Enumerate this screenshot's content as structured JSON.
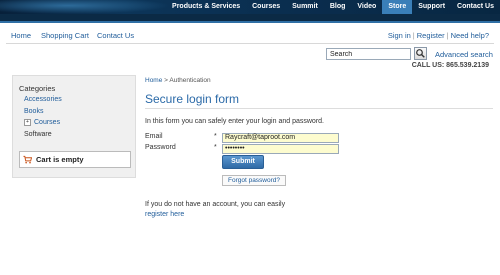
{
  "top_nav": {
    "items": [
      "Products & Services",
      "Courses",
      "Summit",
      "Blog",
      "Video",
      "Store",
      "Support",
      "Contact Us"
    ],
    "active": "Store"
  },
  "secondary_nav": {
    "left": [
      "Home",
      "Shopping Cart",
      "Contact Us"
    ],
    "right": [
      "Sign in",
      "Register",
      "Need help?"
    ]
  },
  "search": {
    "value": "Search",
    "button_icon": "search-icon",
    "advanced_label": "Advanced search"
  },
  "call_us": "CALL US: 865.539.2139",
  "sidebar": {
    "title": "Categories",
    "items": [
      "Accessories",
      "Books",
      "Courses",
      "Software"
    ],
    "cart_text": "Cart is empty",
    "cart_icon": "cart-icon"
  },
  "breadcrumb": {
    "home": "Home",
    "separator": ">",
    "current": "Authentication"
  },
  "page_title": "Secure login form",
  "intro": "In this form you can safely enter your login and password.",
  "form": {
    "email_label": "Email",
    "password_label": "Password",
    "required_marker": "*",
    "email_value": "Raycraft@taproot.com",
    "password_value": "••••••••",
    "submit_label": "Submit",
    "forgot_label": "Forgot password?"
  },
  "no_account_text": "If you do not have an account, you can easily",
  "register_link": "register here",
  "colors": {
    "accent": "#2b6aa8",
    "link": "#1f5c9a",
    "active_tab": "#3a7fb8",
    "input_highlight": "#fdfccf",
    "topbar": "#0a2d4e"
  }
}
